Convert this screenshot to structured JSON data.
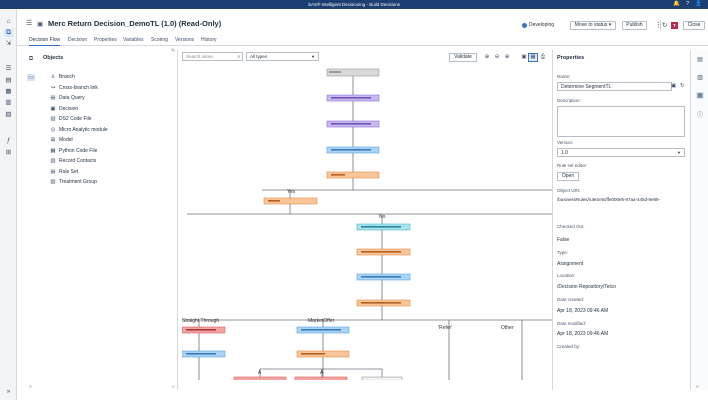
{
  "window": {
    "title": "SAS® Intelligent Decisioning - Build Decisions"
  },
  "titlebar_icons": [
    "bell-icon",
    "help-icon",
    "user-icon"
  ],
  "leftnav": [
    "home-icon",
    "build-decisions-icon",
    "manage-rules-icon",
    "data-icon",
    "models-icon",
    "lookup-tables-icon",
    "code-files-icon",
    "treatments-icon",
    "publish-icon",
    "scenarios-icon",
    "expand-icon"
  ],
  "header": {
    "title": "Merc Return Decision_DemoTL (1.0) (Read-Only)",
    "status": "Developing",
    "move_to_status": "Move to status",
    "publish": "Publish",
    "close": "Close",
    "badge": "T"
  },
  "tabs": [
    "Decision Flow",
    "Decision",
    "Properties",
    "Variables",
    "Scoring",
    "Versions",
    "History"
  ],
  "objects": {
    "heading": "Objects",
    "items": [
      {
        "label": "Branch",
        "icon": "branch-icon"
      },
      {
        "label": "Cross-branch link",
        "icon": "link-icon"
      },
      {
        "label": "Data Query",
        "icon": "data-query-icon"
      },
      {
        "label": "Decision",
        "icon": "decision-icon"
      },
      {
        "label": "DS2 Code File",
        "icon": "code-file-icon"
      },
      {
        "label": "Micro Analytic module",
        "icon": "module-icon"
      },
      {
        "label": "Model",
        "icon": "model-icon"
      },
      {
        "label": "Python Code File",
        "icon": "python-icon"
      },
      {
        "label": "Record Contacts",
        "icon": "record-contacts-icon"
      },
      {
        "label": "Rule Set",
        "icon": "rule-set-icon"
      },
      {
        "label": "Treatment Group",
        "icon": "treatment-group-icon"
      }
    ]
  },
  "canvas": {
    "search_placeholder": "Search name",
    "type_filter": "All types",
    "validate": "Validate"
  },
  "flow_labels": {
    "yes1": "Yes",
    "no1": "No",
    "straight_through": "Straight Through",
    "market_offer": "MarketOffer",
    "refer": "'Refer'",
    "other": "Other",
    "c1": "A",
    "c2": "A"
  },
  "properties": {
    "heading": "Properties",
    "name_label": "Name:",
    "name_value": "Determine SegmentTL",
    "description_label": "Description:",
    "version_label": "Version:",
    "version_value": "1.0",
    "rule_set_editor_label": "Rule set editor:",
    "open_button": "Open",
    "object_uri_label": "Object URI:",
    "object_uri_value": "/businessRules/ruleSets/ffe000e5-97aa-445d-9e89-",
    "checked_out_label": "Checked Out:",
    "checked_out_value": "False",
    "type_label": "Type:",
    "type_value": "Assignment",
    "location_label": "Location:",
    "location_value": "/Decision Repository/Telco",
    "date_created_label": "Date created:",
    "date_created_value": "Apr 18, 2023 09:46 AM",
    "date_modified_label": "Date modified:",
    "date_modified_value": "Apr 18, 2023 09:46 AM",
    "created_by_label": "Created by:"
  },
  "colors": {
    "titlebar": "#1d3e73",
    "accent": "#3572c6",
    "node_gray": "#d9d9d9",
    "node_purple": "#c9b8f0",
    "node_blue": "#aad4f5",
    "node_orange": "#f9c59b",
    "node_red": "#f4a3a3",
    "node_teal": "#a8e3ec"
  }
}
